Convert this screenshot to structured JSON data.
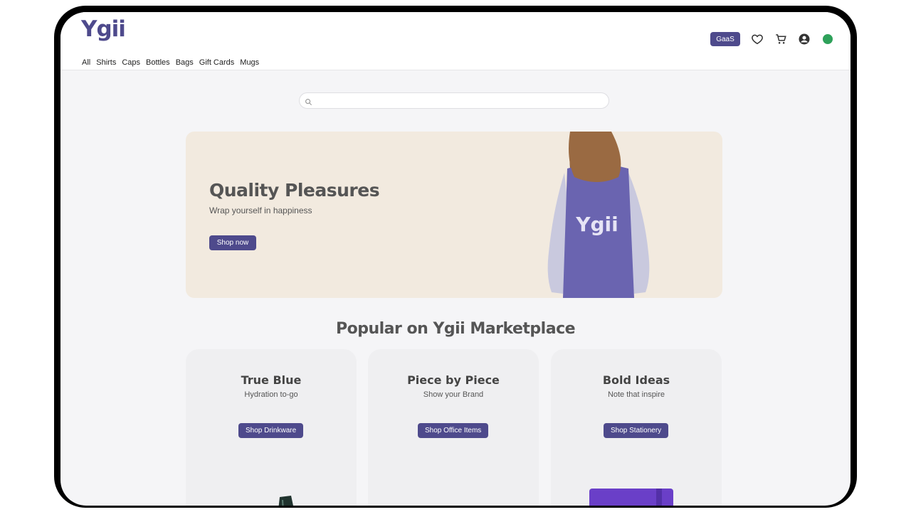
{
  "brand": {
    "logo": "Ygii",
    "accent_color": "#4e4a8c"
  },
  "nav": {
    "items": [
      "All",
      "Shirts",
      "Caps",
      "Bottles",
      "Bags",
      "Gift Cards",
      "Mugs"
    ]
  },
  "header_actions": {
    "gaas_label": "GaaS",
    "icons": [
      "heart-icon",
      "cart-icon",
      "account-icon",
      "status-dot"
    ]
  },
  "search": {
    "placeholder": "",
    "value": ""
  },
  "hero": {
    "title": "Quality Pleasures",
    "subtitle": "Wrap yourself in happiness",
    "button": "Shop now",
    "garment_logo": "Ygii"
  },
  "popular": {
    "title": "Popular on Ygii Marketplace",
    "cards": [
      {
        "title": "True Blue",
        "subtitle": "Hydration to-go",
        "button": "Shop Drinkware"
      },
      {
        "title": "Piece by Piece",
        "subtitle": "Show your Brand",
        "button": "Shop Office Items"
      },
      {
        "title": "Bold Ideas",
        "subtitle": "Note that inspire",
        "button": "Shop Stationery"
      }
    ]
  }
}
